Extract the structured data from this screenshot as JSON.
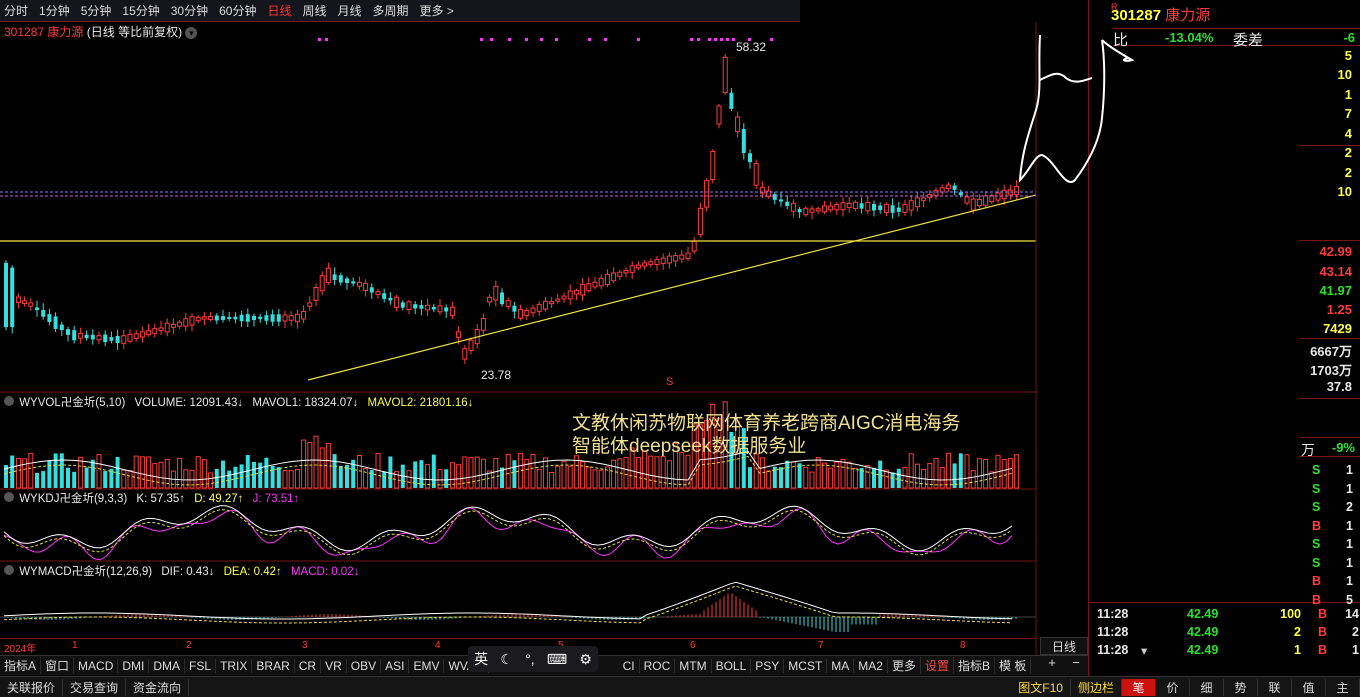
{
  "topbar": {
    "periods": [
      "分时",
      "1分钟",
      "5分钟",
      "15分钟",
      "30分钟",
      "60分钟",
      "日线",
      "周线",
      "月线",
      "多周期",
      "更多 >"
    ],
    "active": "日线"
  },
  "stock": {
    "code_name": "301287 康力源",
    "mode": "(日线 等比前复权)",
    "high_label": "58.32",
    "low_label": "23.78",
    "s_marker": "S"
  },
  "volume_panel": {
    "name": "WYVOL卍金圻(5,10)",
    "volume": "VOLUME: 12091.43↓",
    "mavol1": "MAVOL1: 18324.07↓",
    "mavol2": "MAVOL2: 21801.16↓"
  },
  "kdj_panel": {
    "name": "WYKDJ卍金圻(9,3,3)",
    "k": "K: 57.35↑",
    "d": "D: 49.27↑",
    "j": "J: 73.51↑"
  },
  "macd_panel": {
    "name": "WYMACD卍金圻(12,26,9)",
    "dif": "DIF: 0.43↓",
    "dea": "DEA: 0.42↑",
    "macd": "MACD: 0.02↓"
  },
  "overlay": {
    "line1": "文教休闲苏物联网体育养老跨商AIGC消电海务",
    "line2": "智能体deepseek数据服务业"
  },
  "date_axis": [
    "2024年",
    "1",
    "2",
    "3",
    "4",
    "5",
    "6",
    "7",
    "8"
  ],
  "bottom_tabs": [
    "指标A",
    "窗口",
    "MACD",
    "DMI",
    "DMA",
    "FSL",
    "TRIX",
    "BRAR",
    "CR",
    "VR",
    "OBV",
    "ASI",
    "EMV",
    "WVAD",
    "CI",
    "ROC",
    "MTM",
    "BOLL",
    "PSY",
    "MCST",
    "MA",
    "MA2",
    "更多",
    "设置",
    "指标B",
    "模 板"
  ],
  "bottom_tabs_hl": "设置",
  "bottom_right": {
    "period": "日线",
    "plus": "+",
    "minus": "−"
  },
  "ime": {
    "lang": "英"
  },
  "status": {
    "left": [
      "关联报价",
      "交易查询",
      "资金流向"
    ],
    "f10": "图文F10",
    "side": "侧边栏",
    "tabs": [
      "笔",
      "价",
      "细",
      "势",
      "联",
      "值",
      "主"
    ]
  },
  "quote": {
    "code": "301287",
    "name": "康力源",
    "ratio_label": "比",
    "ratio_value": "-13.04%",
    "diff_label": "委差",
    "diff_value": "-6",
    "order_vols": [
      "5",
      "10",
      "1",
      "7",
      "4",
      "2",
      "2",
      "10"
    ],
    "price1": "42.99",
    "price2": "43.14",
    "price3": "41.97",
    "price4": "1.25",
    "price5": "7429",
    "vol1": "6667万",
    "vol2": "1703万",
    "vol3": "37.8",
    "wan": "万",
    "pct": "-9%"
  },
  "trade_flags": [
    "S",
    "S",
    "S",
    "B",
    "S",
    "S",
    "B",
    "B"
  ],
  "trade_flag_counts": [
    "1",
    "1",
    "2",
    "1",
    "1",
    "1",
    "1",
    "5"
  ],
  "trades": [
    {
      "time": "11:28",
      "price": "42.49",
      "vol": "100",
      "flag": "B",
      "cnt": "14"
    },
    {
      "time": "11:28",
      "price": "42.49",
      "vol": "2",
      "flag": "B",
      "cnt": "2"
    },
    {
      "time": "11:28",
      "price": "42.49",
      "vol": "1",
      "flag": "B",
      "cnt": "1"
    }
  ],
  "colors": {
    "up": "#ff3b3b",
    "down": "#33e0e0",
    "trend": "#f0e040",
    "macd_dif": "#ffffff",
    "macd_dea": "#f0e040"
  }
}
